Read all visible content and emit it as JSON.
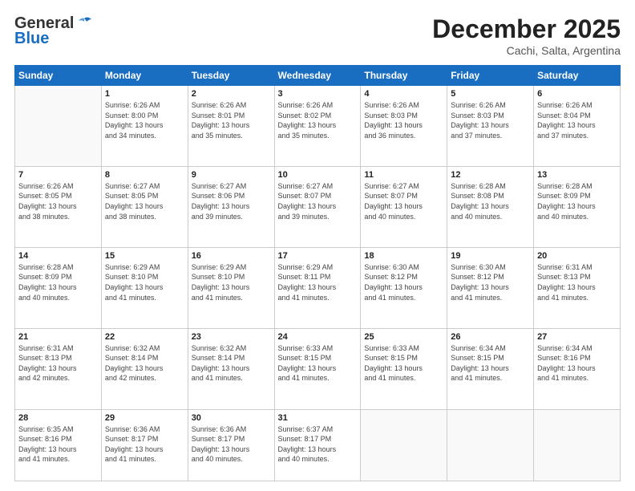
{
  "header": {
    "logo_general": "General",
    "logo_blue": "Blue",
    "main_title": "December 2025",
    "subtitle": "Cachi, Salta, Argentina"
  },
  "days_of_week": [
    "Sunday",
    "Monday",
    "Tuesday",
    "Wednesday",
    "Thursday",
    "Friday",
    "Saturday"
  ],
  "weeks": [
    [
      {
        "day": "",
        "info": ""
      },
      {
        "day": "1",
        "info": "Sunrise: 6:26 AM\nSunset: 8:00 PM\nDaylight: 13 hours\nand 34 minutes."
      },
      {
        "day": "2",
        "info": "Sunrise: 6:26 AM\nSunset: 8:01 PM\nDaylight: 13 hours\nand 35 minutes."
      },
      {
        "day": "3",
        "info": "Sunrise: 6:26 AM\nSunset: 8:02 PM\nDaylight: 13 hours\nand 35 minutes."
      },
      {
        "day": "4",
        "info": "Sunrise: 6:26 AM\nSunset: 8:03 PM\nDaylight: 13 hours\nand 36 minutes."
      },
      {
        "day": "5",
        "info": "Sunrise: 6:26 AM\nSunset: 8:03 PM\nDaylight: 13 hours\nand 37 minutes."
      },
      {
        "day": "6",
        "info": "Sunrise: 6:26 AM\nSunset: 8:04 PM\nDaylight: 13 hours\nand 37 minutes."
      }
    ],
    [
      {
        "day": "7",
        "info": "Sunrise: 6:26 AM\nSunset: 8:05 PM\nDaylight: 13 hours\nand 38 minutes."
      },
      {
        "day": "8",
        "info": "Sunrise: 6:27 AM\nSunset: 8:05 PM\nDaylight: 13 hours\nand 38 minutes."
      },
      {
        "day": "9",
        "info": "Sunrise: 6:27 AM\nSunset: 8:06 PM\nDaylight: 13 hours\nand 39 minutes."
      },
      {
        "day": "10",
        "info": "Sunrise: 6:27 AM\nSunset: 8:07 PM\nDaylight: 13 hours\nand 39 minutes."
      },
      {
        "day": "11",
        "info": "Sunrise: 6:27 AM\nSunset: 8:07 PM\nDaylight: 13 hours\nand 40 minutes."
      },
      {
        "day": "12",
        "info": "Sunrise: 6:28 AM\nSunset: 8:08 PM\nDaylight: 13 hours\nand 40 minutes."
      },
      {
        "day": "13",
        "info": "Sunrise: 6:28 AM\nSunset: 8:09 PM\nDaylight: 13 hours\nand 40 minutes."
      }
    ],
    [
      {
        "day": "14",
        "info": "Sunrise: 6:28 AM\nSunset: 8:09 PM\nDaylight: 13 hours\nand 40 minutes."
      },
      {
        "day": "15",
        "info": "Sunrise: 6:29 AM\nSunset: 8:10 PM\nDaylight: 13 hours\nand 41 minutes."
      },
      {
        "day": "16",
        "info": "Sunrise: 6:29 AM\nSunset: 8:10 PM\nDaylight: 13 hours\nand 41 minutes."
      },
      {
        "day": "17",
        "info": "Sunrise: 6:29 AM\nSunset: 8:11 PM\nDaylight: 13 hours\nand 41 minutes."
      },
      {
        "day": "18",
        "info": "Sunrise: 6:30 AM\nSunset: 8:12 PM\nDaylight: 13 hours\nand 41 minutes."
      },
      {
        "day": "19",
        "info": "Sunrise: 6:30 AM\nSunset: 8:12 PM\nDaylight: 13 hours\nand 41 minutes."
      },
      {
        "day": "20",
        "info": "Sunrise: 6:31 AM\nSunset: 8:13 PM\nDaylight: 13 hours\nand 41 minutes."
      }
    ],
    [
      {
        "day": "21",
        "info": "Sunrise: 6:31 AM\nSunset: 8:13 PM\nDaylight: 13 hours\nand 42 minutes."
      },
      {
        "day": "22",
        "info": "Sunrise: 6:32 AM\nSunset: 8:14 PM\nDaylight: 13 hours\nand 42 minutes."
      },
      {
        "day": "23",
        "info": "Sunrise: 6:32 AM\nSunset: 8:14 PM\nDaylight: 13 hours\nand 41 minutes."
      },
      {
        "day": "24",
        "info": "Sunrise: 6:33 AM\nSunset: 8:15 PM\nDaylight: 13 hours\nand 41 minutes."
      },
      {
        "day": "25",
        "info": "Sunrise: 6:33 AM\nSunset: 8:15 PM\nDaylight: 13 hours\nand 41 minutes."
      },
      {
        "day": "26",
        "info": "Sunrise: 6:34 AM\nSunset: 8:15 PM\nDaylight: 13 hours\nand 41 minutes."
      },
      {
        "day": "27",
        "info": "Sunrise: 6:34 AM\nSunset: 8:16 PM\nDaylight: 13 hours\nand 41 minutes."
      }
    ],
    [
      {
        "day": "28",
        "info": "Sunrise: 6:35 AM\nSunset: 8:16 PM\nDaylight: 13 hours\nand 41 minutes."
      },
      {
        "day": "29",
        "info": "Sunrise: 6:36 AM\nSunset: 8:17 PM\nDaylight: 13 hours\nand 41 minutes."
      },
      {
        "day": "30",
        "info": "Sunrise: 6:36 AM\nSunset: 8:17 PM\nDaylight: 13 hours\nand 40 minutes."
      },
      {
        "day": "31",
        "info": "Sunrise: 6:37 AM\nSunset: 8:17 PM\nDaylight: 13 hours\nand 40 minutes."
      },
      {
        "day": "",
        "info": ""
      },
      {
        "day": "",
        "info": ""
      },
      {
        "day": "",
        "info": ""
      }
    ]
  ]
}
